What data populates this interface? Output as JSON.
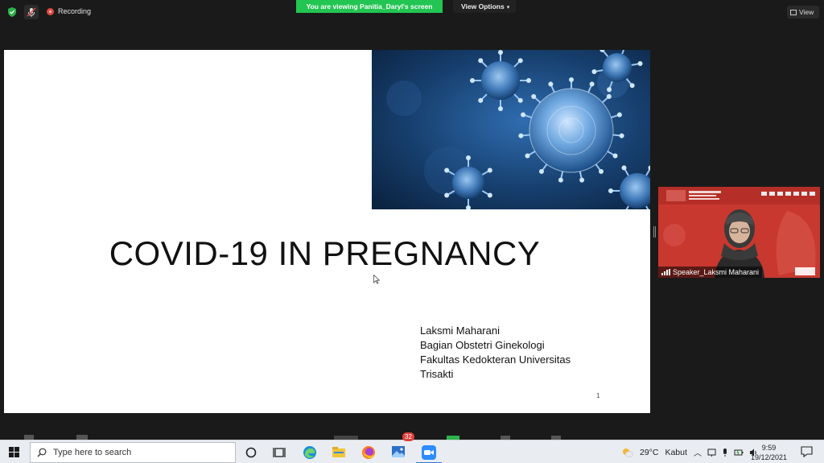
{
  "topbar": {
    "recording_label": "Recording",
    "viewing_banner": "You are viewing Panitia_Daryl's screen",
    "view_options_label": "View Options",
    "view_label": "View"
  },
  "slide": {
    "title": "COVID-19 IN PREGNANCY",
    "author_lines": [
      "Laksmi Maharani",
      "Bagian Obstetri Ginekologi",
      "Fakultas Kedokteran Universitas",
      "Trisakti"
    ],
    "page_number": "1"
  },
  "video": {
    "label": "Speaker_Laksmi Maharani"
  },
  "taskbar": {
    "search_placeholder": "Type here to search",
    "weather_temp": "29°C",
    "weather_desc": "Kabut",
    "time": "9:59",
    "date": "19/12/2021",
    "badge_count": "32"
  },
  "colors": {
    "banner_green": "#23c552",
    "record_red": "#e04a3f",
    "virus_blue": "#1d4e86",
    "video_bg": "#c8382f"
  }
}
